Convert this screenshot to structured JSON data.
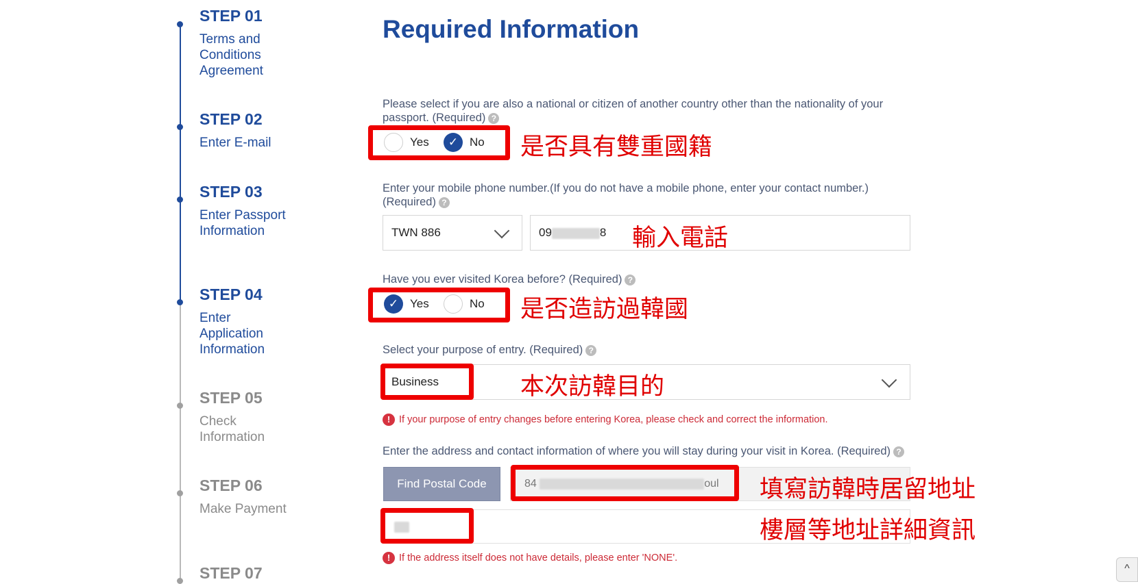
{
  "steps": [
    {
      "number": "STEP 01",
      "label": "Terms and Conditions Agreement",
      "state": "completed"
    },
    {
      "number": "STEP 02",
      "label": "Enter E-mail",
      "state": "completed"
    },
    {
      "number": "STEP 03",
      "label": "Enter Passport Information",
      "state": "completed"
    },
    {
      "number": "STEP 04",
      "label": "Enter Application Information",
      "state": "current"
    },
    {
      "number": "STEP 05",
      "label": "Check Information",
      "state": "upcoming"
    },
    {
      "number": "STEP 06",
      "label": "Make Payment",
      "state": "upcoming"
    },
    {
      "number": "STEP 07",
      "label": "",
      "state": "upcoming"
    }
  ],
  "page_title": "Required Information",
  "dual_nationality": {
    "question_line1": "Please select if you are also a national or citizen of another country other than the nationality of your",
    "question_line2": "passport. (Required)",
    "options": [
      "Yes",
      "No"
    ],
    "selected": "No"
  },
  "phone": {
    "question_line1": "Enter your mobile phone number.(If you do not have a mobile phone, enter your contact number.)",
    "question_line2": "(Required)",
    "country_code": "TWN 886",
    "number_prefix": "09",
    "number_suffix": "8"
  },
  "visited_korea": {
    "question": "Have you ever visited Korea before? (Required)",
    "options": [
      "Yes",
      "No"
    ],
    "selected": "Yes"
  },
  "purpose": {
    "question": "Select your purpose of entry. (Required)",
    "value": "Business",
    "warning": "If your purpose of entry changes before entering Korea, please check and correct the information."
  },
  "address": {
    "question": "Enter the address and contact information of where you will stay during your visit in Korea. (Required)",
    "find_postal_code": "Find Postal Code",
    "address_prefix": "84",
    "address_suffix": "oul",
    "warning": "If the address itself does not have details, please enter 'NONE'."
  },
  "annotations": {
    "dual_nationality": "是否具有雙重國籍",
    "phone": "輸入電話",
    "visited_korea": "是否造訪過韓國",
    "purpose": "本次訪韓目的",
    "address": "填寫訪韓時居留地址",
    "address_detail": "樓層等地址詳細資訊"
  },
  "colors": {
    "primary": "#1f4b9b",
    "annotation_red": "#ee0000",
    "warning_red": "#cc2a36",
    "inactive_gray": "#8a8a8a"
  },
  "icons": {
    "help": "?",
    "warning": "!",
    "check": "✓",
    "scroll_top": "^"
  }
}
